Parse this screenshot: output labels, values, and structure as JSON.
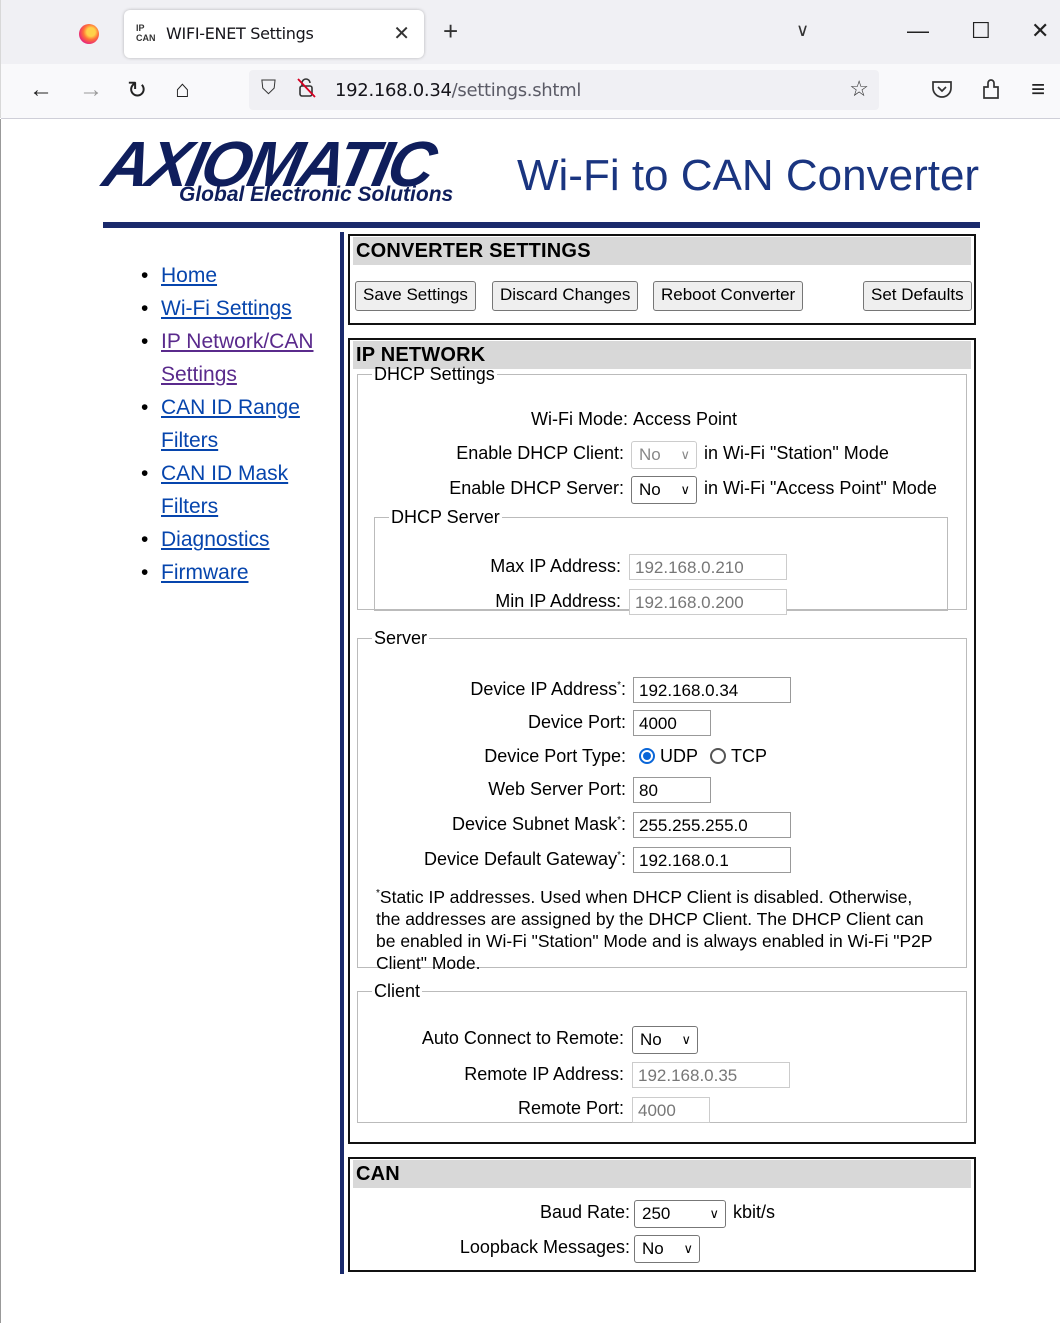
{
  "browser": {
    "tab_title": "WIFI-ENET Settings",
    "tab_favicon": "IP CAN",
    "url_host": "192.168.0.34",
    "url_path": "/settings.shtml"
  },
  "header": {
    "logo_text": "AXIOMATIC",
    "logo_tagline": "Global Electronic Solutions",
    "title": "Wi-Fi to CAN Converter"
  },
  "nav": {
    "home": "Home",
    "wifi": "Wi-Fi Settings",
    "ipcan_1": "IP Network/CAN",
    "ipcan_2": "Settings",
    "range_1": "CAN ID Range",
    "range_2": "Filters",
    "mask_1": "CAN ID Mask",
    "mask_2": "Filters",
    "diagnostics": "Diagnostics",
    "firmware": "Firmware"
  },
  "converter": {
    "heading": "CONVERTER SETTINGS",
    "save": "Save Settings",
    "discard": "Discard Changes",
    "reboot": "Reboot Converter",
    "defaults": "Set Defaults"
  },
  "ip": {
    "heading": "IP NETWORK",
    "dhcp": {
      "legend": "DHCP Settings",
      "wifi_mode_label": "Wi-Fi Mode:",
      "wifi_mode_value": "Access Point",
      "client_label": "Enable DHCP Client:",
      "client_value": "No",
      "client_suffix": "in Wi-Fi \"Station\" Mode",
      "server_label": "Enable DHCP Server:",
      "server_value": "No",
      "server_suffix": "in Wi-Fi \"Access Point\" Mode",
      "server_group": {
        "legend": "DHCP Server",
        "max_label": "Max IP Address:",
        "max_value": "192.168.0.210",
        "min_label": "Min IP Address:",
        "min_value": "192.168.0.200"
      }
    },
    "server": {
      "legend": "Server",
      "ip_label": "Device IP Address",
      "ip_value": "192.168.0.34",
      "port_label": "Device Port:",
      "port_value": "4000",
      "type_label": "Device Port Type:",
      "udp": "UDP",
      "tcp": "TCP",
      "web_label": "Web Server Port:",
      "web_value": "80",
      "mask_label": "Device Subnet Mask",
      "mask_value": "255.255.255.0",
      "gw_label": "Device Default Gateway",
      "gw_value": "192.168.0.1",
      "asterisk": "*",
      "colon": ":",
      "note_1": "Static IP addresses. Used when DHCP Client is disabled. Otherwise,",
      "note_2": "the addresses are assigned by the DHCP Client. The DHCP Client can",
      "note_3": "be enabled in Wi-Fi \"Station\" Mode and is always enabled in Wi-Fi \"P2P",
      "note_4": "Client\" Mode."
    },
    "client": {
      "legend": "Client",
      "auto_label": "Auto Connect to Remote:",
      "auto_value": "No",
      "rip_label": "Remote IP Address:",
      "rip_value": "192.168.0.35",
      "rport_label": "Remote Port:",
      "rport_value": "4000"
    }
  },
  "can": {
    "heading": "CAN",
    "baud_label": "Baud Rate:",
    "baud_value": "250",
    "baud_unit": "kbit/s",
    "loop_label": "Loopback Messages:",
    "loop_value": "No"
  },
  "icons": {
    "chevron": "∨",
    "close": "✕",
    "plus": "+",
    "minimize": "—",
    "maximize": "☐",
    "back": "←",
    "forward": "→",
    "reload": "↻",
    "home": "⌂",
    "shield": "⛉",
    "lock": "🔓",
    "star": "☆",
    "pocket": "⛉",
    "extensions": "⇱",
    "menu": "≡"
  }
}
